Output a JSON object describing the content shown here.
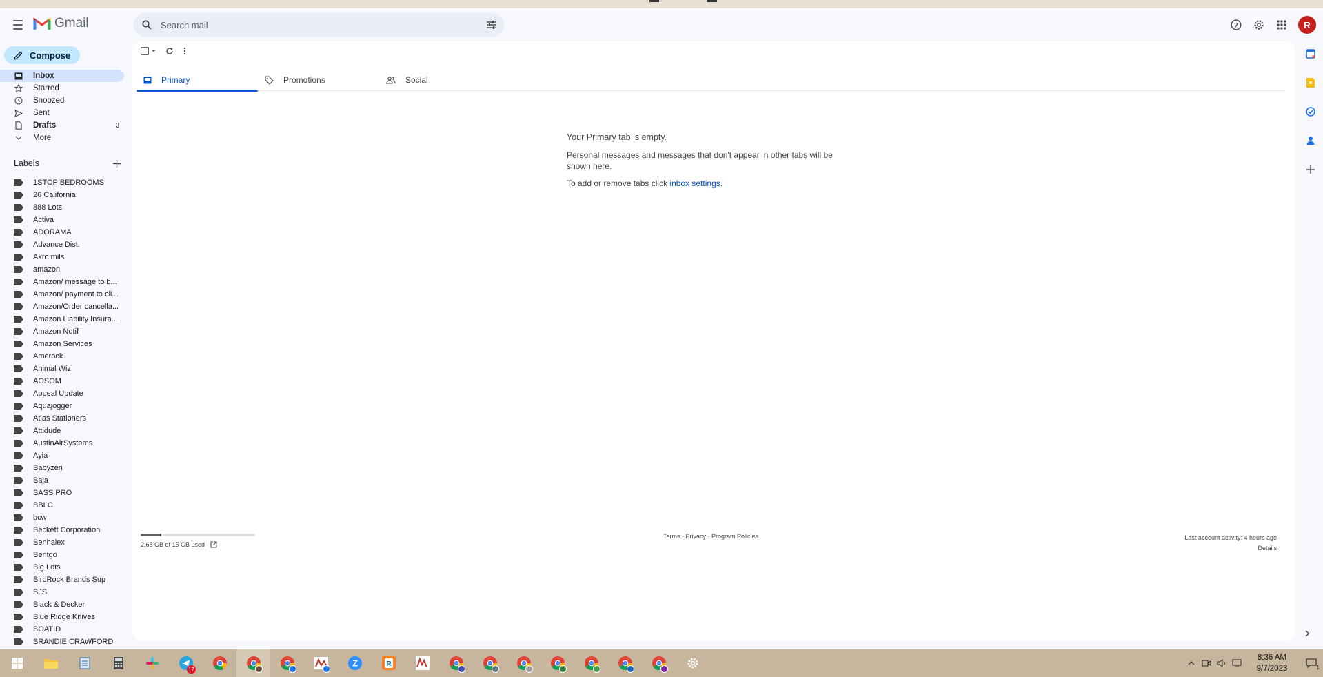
{
  "app": {
    "name": "Gmail"
  },
  "search": {
    "placeholder": "Search mail"
  },
  "header": {
    "avatar_initial": "R"
  },
  "compose": {
    "label": "Compose"
  },
  "nav": [
    {
      "label": "Inbox",
      "icon": "inbox-icon",
      "active": true,
      "count": ""
    },
    {
      "label": "Starred",
      "icon": "star-icon",
      "active": false,
      "count": ""
    },
    {
      "label": "Snoozed",
      "icon": "clock-icon",
      "active": false,
      "count": ""
    },
    {
      "label": "Sent",
      "icon": "send-icon",
      "active": false,
      "count": ""
    },
    {
      "label": "Drafts",
      "icon": "draft-icon",
      "active": false,
      "count": "3"
    },
    {
      "label": "More",
      "icon": "chevron-down-icon",
      "active": false,
      "count": ""
    }
  ],
  "labels": {
    "header": "Labels",
    "items": [
      "1STOP BEDROOMS",
      "26 California",
      "888 Lots",
      "Activa",
      "ADORAMA",
      "Advance Dist.",
      "Akro mils",
      "amazon",
      "Amazon/ message to b...",
      "Amazon/ payment to cli...",
      "Amazon/Order cancella...",
      "Amazon Liability Insura...",
      "Amazon Notif",
      "Amazon Services",
      "Amerock",
      "Animal Wiz",
      "AOSOM",
      "Appeal Update",
      "Aquajogger",
      "Atlas Stationers",
      "Attidude",
      "AustinAirSystems",
      "Ayia",
      "Babyzen",
      "Baja",
      "BASS PRO",
      "BBLC",
      "bcw",
      "Beckett Corporation",
      "Benhalex",
      "Bentgo",
      "Big Lots",
      "BirdRock Brands Sup",
      "BJS",
      "Black & Decker",
      "Blue Ridge Knives",
      "BOATID",
      "BRANDIE CRAWFORD"
    ]
  },
  "tabs": [
    {
      "label": "Primary",
      "icon": "inbox-tab-icon",
      "active": true
    },
    {
      "label": "Promotions",
      "icon": "tag-icon",
      "active": false
    },
    {
      "label": "Social",
      "icon": "people-icon",
      "active": false
    }
  ],
  "empty_state": {
    "title": "Your Primary tab is empty.",
    "line1": "Personal messages and messages that don't appear in other tabs will be shown here.",
    "line2_prefix": "To add or remove tabs click ",
    "line2_link": "inbox settings",
    "line2_suffix": "."
  },
  "footer": {
    "storage_text": "2.68 GB of 15 GB used",
    "storage_used_fraction": 0.18,
    "links": "Terms · Privacy · Program Policies",
    "last_activity": "Last account activity: 4 hours ago",
    "details": "Details"
  },
  "taskbar": {
    "time": "8:36 AM",
    "date": "9/7/2023",
    "badge_telegram": "17",
    "notification_count": "1"
  },
  "colors": {
    "accent": "#0b57d0",
    "compose_bg": "#c2e7ff",
    "active_nav": "#d3e3fd",
    "avatar": "#c5221f",
    "taskbar": "#c7b69d"
  }
}
